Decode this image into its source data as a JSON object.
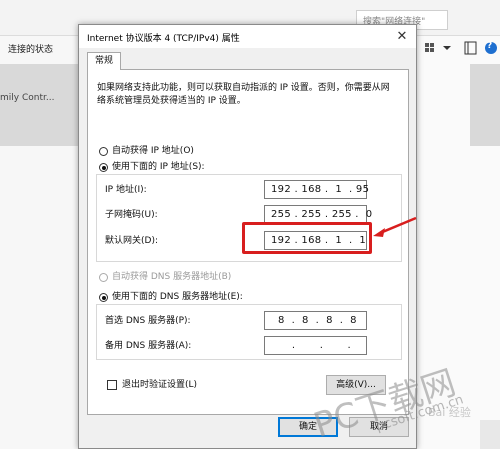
{
  "background": {
    "search_placeholder": "搜索\"网络连接\"",
    "status_label": "连接的状态",
    "item_label": "mily Contr...",
    "help_glyph": "?"
  },
  "dialog": {
    "title": "Internet 协议版本 4 (TCP/IPv4) 属性",
    "close_glyph": "✕",
    "tab_label": "常规",
    "description": [
      "如果网络支持此功能，则可以获取自动指派的 IP 设置。否则，你需要从网",
      "络系统管理员处获得适当的 IP 设置。"
    ],
    "radio_auto_ip": "自动获得 IP 地址(O)",
    "radio_manual_ip": "使用下面的 IP 地址(S):",
    "ip_label": "IP 地址(I):",
    "ip_value": "192 . 168 .  1  . 95",
    "mask_label": "子网掩码(U):",
    "mask_value": "255 . 255 . 255 .  0",
    "gateway_label": "默认网关(D):",
    "gateway_value": "192 . 168 .  1  .  1",
    "radio_auto_dns": "自动获得 DNS 服务器地址(B)",
    "radio_manual_dns": "使用下面的 DNS 服务器地址(E):",
    "preferred_dns_label": "首选 DNS 服务器(P):",
    "preferred_dns_value": "  8  .  8  .  8  .  8",
    "alternate_dns_label": "备用 DNS 服务器(A):",
    "alternate_dns_value": "      .       .       .",
    "validate_label": "退出时验证设置(L)",
    "advanced_button": "高级(V)...",
    "ok_button": "确定",
    "cancel_button": "取消"
  },
  "watermark": {
    "brand": "PC下载网",
    "url": "pcsoft.com.cn",
    "overlay": "Bai 经验"
  },
  "colors": {
    "highlight": "#d81e1e",
    "accent": "#0078d7"
  }
}
